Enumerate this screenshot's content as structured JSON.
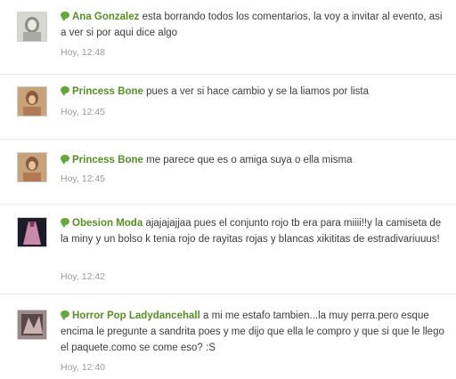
{
  "comments": [
    {
      "author": "Ana Gonzalez",
      "text": "esta borrando todos los comentarios, la voy a invitar al evento, asi a ver si por aqui dice algo",
      "time": "Hoy, 12:48",
      "avatar_icon": "stone-statue-avatar"
    },
    {
      "author": "Princess Bone",
      "text": "pues a ver si hace cambio y se la liamos por lista",
      "time": "Hoy, 12:45",
      "avatar_icon": "portrait-avatar"
    },
    {
      "author": "Princess Bone",
      "text": "me parece que es o amiga suya o ella misma",
      "time": "Hoy, 12:45",
      "avatar_icon": "portrait-avatar"
    },
    {
      "author": "Obesion Moda",
      "text": "ajajajajjaa pues el conjunto rojo tb era para miiii!!y la camiseta de la miny y un bolso k tenia rojo de rayitas rojas y blancas xikititas de estradivariuuus!",
      "time": "Hoy, 12:42",
      "avatar_icon": "dress-avatar"
    },
    {
      "author": "Horror Pop Ladydancehall",
      "text": "a mi me estafo tambien...la muy perra.pero esque encima le pregunte a sandrita poes y me dijo que ella le compro y que si que le llego el paquete.como se come eso? :S",
      "time": "Hoy, 12:40",
      "avatar_icon": "fashion-avatar"
    }
  ],
  "colors": {
    "author_link": "#568f24",
    "bubble_icon": "#67a73a",
    "timestamp": "#9a9a9a",
    "separator": "#e6e6e6"
  }
}
